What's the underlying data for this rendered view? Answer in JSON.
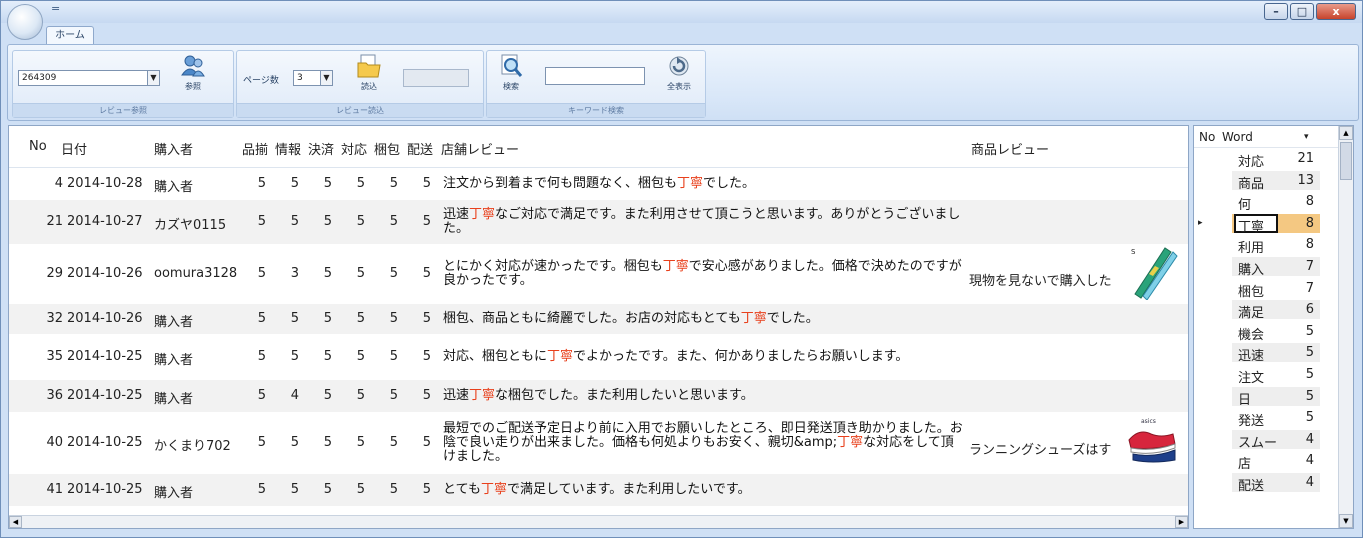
{
  "window": {
    "qat_symbol": "=",
    "controls": {
      "minimize": "–",
      "maximize": "□",
      "close": "x"
    }
  },
  "ribbon": {
    "tab_home": "ホーム",
    "review_ref": {
      "combo_value": "264309",
      "button_label": "参照",
      "group_label": "レビュー参照"
    },
    "review_read": {
      "pages_label": "ページ数",
      "pages_value": "3",
      "button_label": "読込",
      "group_label": "レビュー読込"
    },
    "keyword_search": {
      "search_label": "検索",
      "show_all_label": "全表示",
      "group_label": "キーワード検索",
      "input_value": ""
    }
  },
  "grid": {
    "columns": [
      "No",
      "日付",
      "購入者",
      "品揃",
      "情報",
      "決済",
      "対応",
      "梱包",
      "配送",
      "店舗レビュー",
      "商品レビュー"
    ],
    "rows": [
      {
        "no": "4",
        "date": "2014-10-28",
        "buyer": "購入者",
        "s1": "5",
        "s2": "5",
        "s3": "5",
        "s4": "5",
        "s5": "5",
        "s6": "5",
        "review_parts": [
          [
            "注文から到着まで何も問題なく、梱包も",
            false
          ],
          [
            "丁寧",
            true
          ],
          [
            "でした。",
            false
          ]
        ],
        "product_review": ""
      },
      {
        "no": "21",
        "date": "2014-10-27",
        "buyer": "カズヤ0115",
        "s1": "5",
        "s2": "5",
        "s3": "5",
        "s4": "5",
        "s5": "5",
        "s6": "5",
        "review_parts": [
          [
            "迅速",
            false
          ],
          [
            "丁寧",
            true
          ],
          [
            "なご対応で満足です。また利用させて頂こうと思います。ありがとうございました。",
            false
          ]
        ],
        "product_review": ""
      },
      {
        "no": "29",
        "date": "2014-10-26",
        "buyer": "oomura3128",
        "s1": "5",
        "s2": "3",
        "s3": "5",
        "s4": "5",
        "s5": "5",
        "s6": "5",
        "review_parts": [
          [
            "とにかく対応が速かったです。梱包も",
            false
          ],
          [
            "丁寧",
            true
          ],
          [
            "で安心感がありました。価格で決めたのですが良かったです。",
            false
          ]
        ],
        "product_review": "現物を見ないで購入した"
      },
      {
        "no": "32",
        "date": "2014-10-26",
        "buyer": "購入者",
        "s1": "5",
        "s2": "5",
        "s3": "5",
        "s4": "5",
        "s5": "5",
        "s6": "5",
        "review_parts": [
          [
            "梱包、商品ともに綺麗でした。お店の対応もとても",
            false
          ],
          [
            "丁寧",
            true
          ],
          [
            "でした。",
            false
          ]
        ],
        "product_review": ""
      },
      {
        "no": "35",
        "date": "2014-10-25",
        "buyer": "購入者",
        "s1": "5",
        "s2": "5",
        "s3": "5",
        "s4": "5",
        "s5": "5",
        "s6": "5",
        "review_parts": [
          [
            "対応、梱包ともに",
            false
          ],
          [
            "丁寧",
            true
          ],
          [
            "でよかったです。また、何かありましたらお願いします。",
            false
          ]
        ],
        "product_review": ""
      },
      {
        "no": "36",
        "date": "2014-10-25",
        "buyer": "購入者",
        "s1": "5",
        "s2": "4",
        "s3": "5",
        "s4": "5",
        "s5": "5",
        "s6": "5",
        "review_parts": [
          [
            "迅速",
            false
          ],
          [
            "丁寧",
            true
          ],
          [
            "な梱包でした。また利用したいと思います。",
            false
          ]
        ],
        "product_review": ""
      },
      {
        "no": "40",
        "date": "2014-10-25",
        "buyer": "かくまり702",
        "s1": "5",
        "s2": "5",
        "s3": "5",
        "s4": "5",
        "s5": "5",
        "s6": "5",
        "review_parts": [
          [
            "最短でのご配送予定日より前に入用でお願いしたところ、即日発送頂き助かりました。お陰で良い走りが出来ました。価格も何処よりもお安く、親切&amp;",
            false
          ],
          [
            "丁寧",
            true
          ],
          [
            "な対応をして頂けました。",
            false
          ]
        ],
        "product_review": "ランニングシューズはす"
      },
      {
        "no": "41",
        "date": "2014-10-25",
        "buyer": "購入者",
        "s1": "5",
        "s2": "5",
        "s3": "5",
        "s4": "5",
        "s5": "5",
        "s6": "5",
        "review_parts": [
          [
            "とても",
            false
          ],
          [
            "丁寧",
            true
          ],
          [
            "で満足しています。また利用したいです。",
            false
          ]
        ],
        "product_review": ""
      }
    ]
  },
  "wordlist": {
    "columns": [
      "No",
      "Word"
    ],
    "sort_symbol": "▾",
    "selected_marker": "▸",
    "items": [
      {
        "word": "対応",
        "count": "21"
      },
      {
        "word": "商品",
        "count": "13"
      },
      {
        "word": "何",
        "count": "8"
      },
      {
        "word": "丁寧",
        "count": "8",
        "selected": true
      },
      {
        "word": "利用",
        "count": "8"
      },
      {
        "word": "購入",
        "count": "7"
      },
      {
        "word": "梱包",
        "count": "7"
      },
      {
        "word": "満足",
        "count": "6"
      },
      {
        "word": "機会",
        "count": "5"
      },
      {
        "word": "迅速",
        "count": "5"
      },
      {
        "word": "注文",
        "count": "5"
      },
      {
        "word": "日",
        "count": "5"
      },
      {
        "word": "発送",
        "count": "5"
      },
      {
        "word": "スムー",
        "count": "4"
      },
      {
        "word": "店",
        "count": "4"
      },
      {
        "word": "配送",
        "count": "4"
      }
    ]
  },
  "colors": {
    "highlight": "#e8401c",
    "selected_word_bg": "#f4c882",
    "accent": "#6f8fb9"
  }
}
